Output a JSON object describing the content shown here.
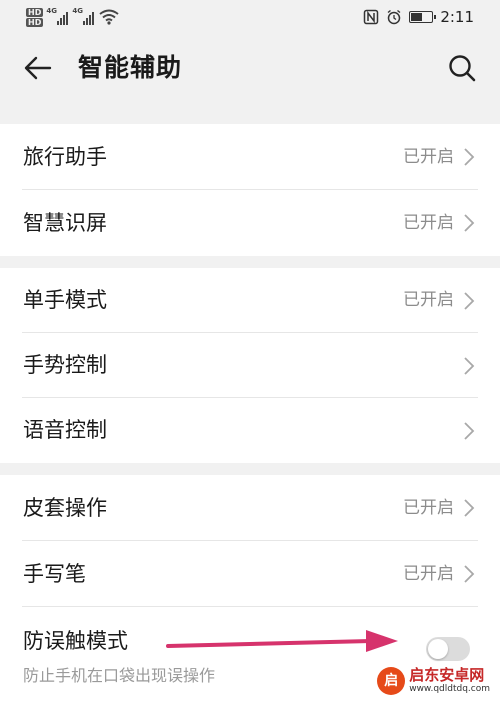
{
  "status_bar": {
    "hd1": "HD",
    "hd2": "HD",
    "sig1_label": "4G",
    "sig2_label": "4G",
    "time": "2:11",
    "battery_level": 0.6,
    "icons": [
      "nfc-icon",
      "alarm-icon",
      "battery-icon",
      "wifi-icon"
    ]
  },
  "header": {
    "title": "智能辅助",
    "back_icon": "arrow-left-icon",
    "search_icon": "search-icon"
  },
  "groups": [
    {
      "items": [
        {
          "label": "旅行助手",
          "status": "已开启"
        },
        {
          "label": "智慧识屏",
          "status": "已开启"
        }
      ]
    },
    {
      "items": [
        {
          "label": "单手模式",
          "status": "已开启"
        },
        {
          "label": "手势控制",
          "status": ""
        },
        {
          "label": "语音控制",
          "status": ""
        }
      ]
    },
    {
      "items": [
        {
          "label": "皮套操作",
          "status": "已开启"
        },
        {
          "label": "手写笔",
          "status": "已开启"
        }
      ],
      "toggle_item": {
        "label": "防误触模式",
        "sub": "防止手机在口袋出现误操作",
        "on": false
      }
    }
  ],
  "annotation": {
    "arrow_color": "#d6336c"
  },
  "watermark": {
    "title": "启东安卓网",
    "url": "www.qdldtdq.com",
    "logo_glyph": "启"
  },
  "colors": {
    "background": "#f1f1f1",
    "card": "#ffffff",
    "secondary_text": "#8c8c8c"
  }
}
